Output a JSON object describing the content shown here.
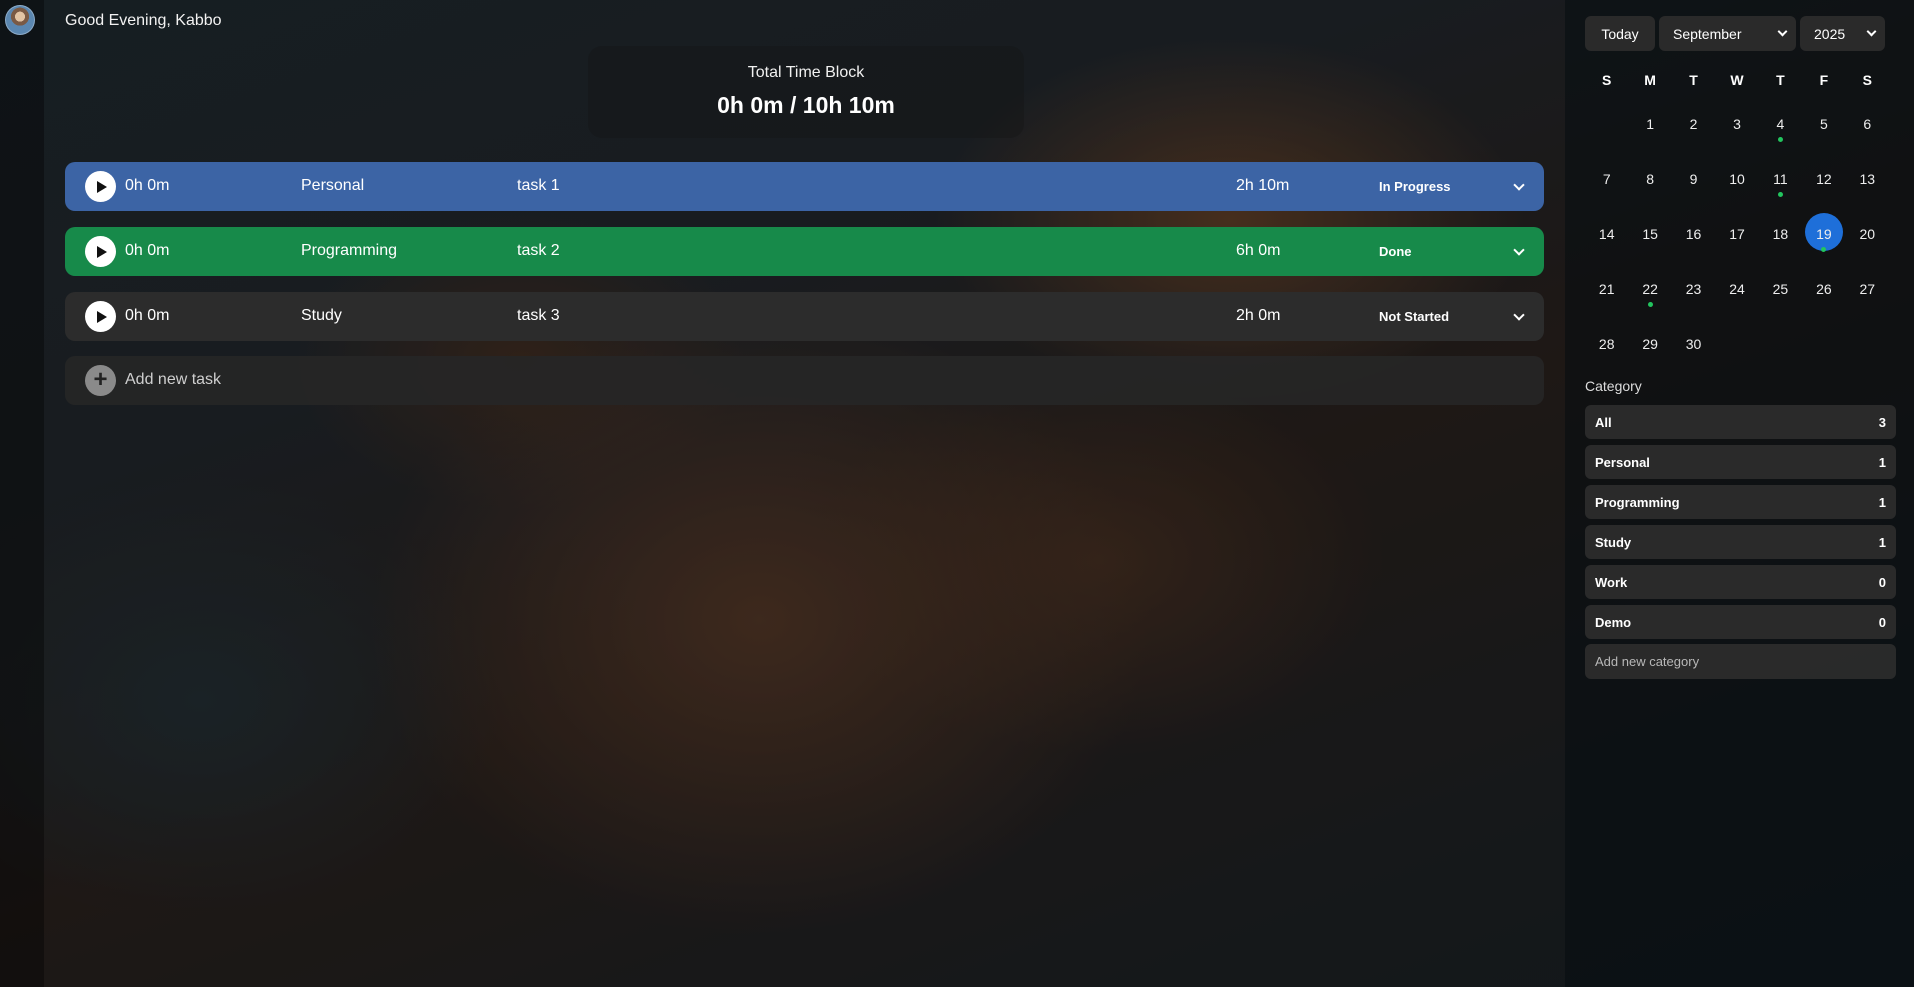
{
  "header": {
    "greeting": "Good Evening, Kabbo"
  },
  "total": {
    "label": "Total Time Block",
    "value": "0h 0m / 10h 10m"
  },
  "tasks": [
    {
      "elapsed": "0h 0m",
      "category": "Personal",
      "name": "task 1",
      "duration": "2h 10m",
      "status": "In Progress",
      "color": "#3c64a5"
    },
    {
      "elapsed": "0h 0m",
      "category": "Programming",
      "name": "task 2",
      "duration": "6h 0m",
      "status": "Done",
      "color": "#178a4a"
    },
    {
      "elapsed": "0h 0m",
      "category": "Study",
      "name": "task 3",
      "duration": "2h 0m",
      "status": "Not Started",
      "color": "#2c2c2c"
    }
  ],
  "add_task": {
    "label": "Add new task"
  },
  "calendar": {
    "today_label": "Today",
    "month": "September",
    "year": "2025",
    "weekdays": [
      "S",
      "M",
      "T",
      "W",
      "T",
      "F",
      "S"
    ],
    "days": [
      "1",
      "2",
      "3",
      "4",
      "5",
      "6",
      "7",
      "8",
      "9",
      "10",
      "11",
      "12",
      "13",
      "14",
      "15",
      "16",
      "17",
      "18",
      "19",
      "20",
      "21",
      "22",
      "23",
      "24",
      "25",
      "26",
      "27",
      "28",
      "29",
      "30"
    ],
    "selected_day": "19",
    "days_with_tasks": [
      "4",
      "11",
      "19",
      "22"
    ],
    "selected_color": "#1e6fd9",
    "dot_color": "#22c55e"
  },
  "categories": {
    "title": "Category",
    "items": [
      {
        "label": "All",
        "count": "3"
      },
      {
        "label": "Personal",
        "count": "1"
      },
      {
        "label": "Programming",
        "count": "1"
      },
      {
        "label": "Study",
        "count": "1"
      },
      {
        "label": "Work",
        "count": "0"
      },
      {
        "label": "Demo",
        "count": "0"
      }
    ],
    "add_placeholder": "Add new category"
  }
}
